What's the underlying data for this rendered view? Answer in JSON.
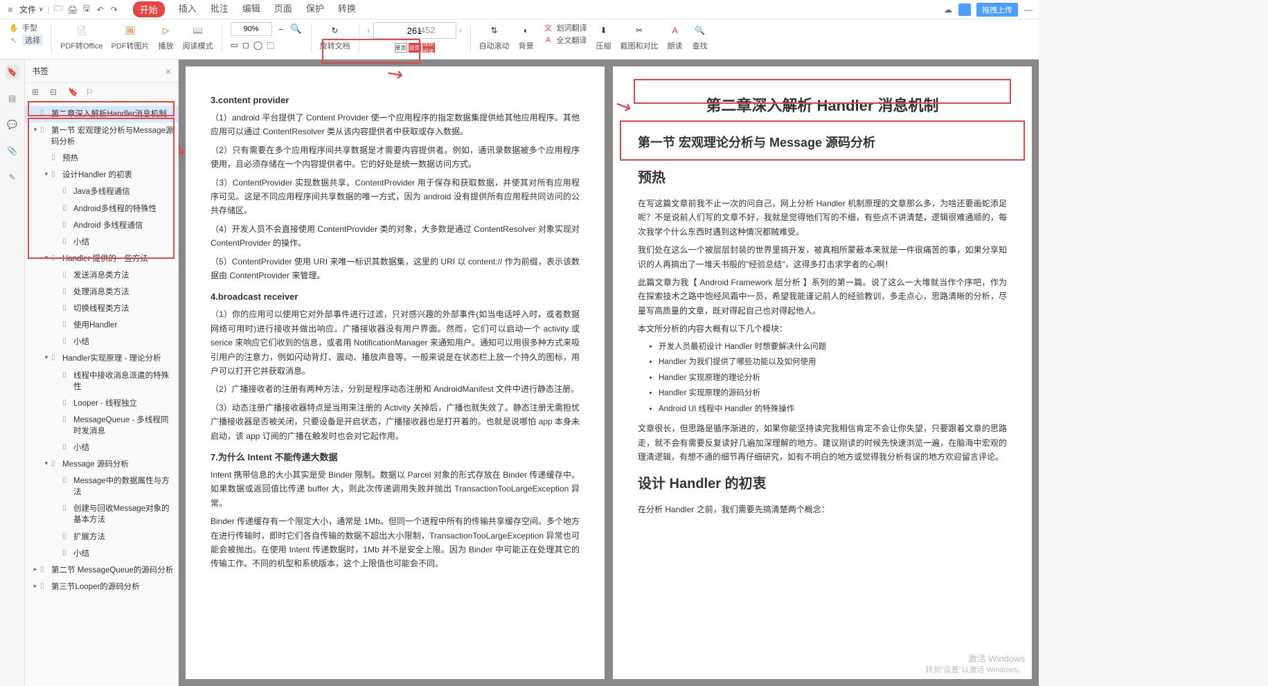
{
  "menubar": {
    "file": "文件",
    "tabs": [
      "开始",
      "插入",
      "批注",
      "编辑",
      "页面",
      "保护",
      "转换"
    ],
    "active_tab": 0,
    "upload": "拖拽上传"
  },
  "toolbar": {
    "hand": "手型",
    "select": "选择",
    "pdf_to_office": "PDF转Office",
    "pdf_to_image": "PDF转图片",
    "play": "播放",
    "read_mode": "阅读模式",
    "zoom_value": "90%",
    "rotate": "旋转文档",
    "page_current": "261",
    "page_total": "/452",
    "single_page": "单页",
    "double_page": "双页",
    "continuous": "连续阅读",
    "auto_scroll": "自动滚动",
    "background": "背景",
    "word_translate": "划词翻译",
    "full_translate": "全文翻译",
    "compress": "压缩",
    "screenshot": "截图和对比",
    "read_aloud": "朗读",
    "find": "查找"
  },
  "bookmark": {
    "title": "书签",
    "items": [
      {
        "level": 0,
        "exp": "",
        "text": "第二章深入解析Handler消息机制",
        "selected": true
      },
      {
        "level": 0,
        "exp": "▾",
        "text": "第一节 宏观理论分析与Message源码分析"
      },
      {
        "level": 1,
        "exp": "",
        "text": "预热"
      },
      {
        "level": 1,
        "exp": "▾",
        "text": "设计Handler 的初衷"
      },
      {
        "level": 2,
        "exp": "",
        "text": "Java多线程通信"
      },
      {
        "level": 2,
        "exp": "",
        "text": "Android多线程的特殊性"
      },
      {
        "level": 2,
        "exp": "",
        "text": "Android 多线程通信"
      },
      {
        "level": 2,
        "exp": "",
        "text": "小结"
      },
      {
        "level": 1,
        "exp": "▾",
        "text": "Handler 提供的一些方法"
      },
      {
        "level": 2,
        "exp": "",
        "text": "发送消息类方法"
      },
      {
        "level": 2,
        "exp": "",
        "text": "处理消息类方法"
      },
      {
        "level": 2,
        "exp": "",
        "text": "切换线程类方法"
      },
      {
        "level": 2,
        "exp": "",
        "text": "使用Handler"
      },
      {
        "level": 2,
        "exp": "",
        "text": "小结"
      },
      {
        "level": 1,
        "exp": "▾",
        "text": "Handler实现原理 - 理论分析"
      },
      {
        "level": 2,
        "exp": "",
        "text": "线程中接收消息派遣的特殊性"
      },
      {
        "level": 2,
        "exp": "",
        "text": "Looper - 线程独立"
      },
      {
        "level": 2,
        "exp": "",
        "text": "MessageQueue - 多线程同时发消息"
      },
      {
        "level": 2,
        "exp": "",
        "text": "小结"
      },
      {
        "level": 1,
        "exp": "▾",
        "text": "Message 源码分析"
      },
      {
        "level": 2,
        "exp": "",
        "text": "Message中的数据属性与方法"
      },
      {
        "level": 2,
        "exp": "",
        "text": "创建与回收Message对象的基本方法"
      },
      {
        "level": 2,
        "exp": "",
        "text": "扩展方法"
      },
      {
        "level": 2,
        "exp": "",
        "text": "小结"
      },
      {
        "level": 0,
        "exp": "▸",
        "text": "第二节 MessageQueue的源码分析"
      },
      {
        "level": 0,
        "exp": "▸",
        "text": "第三节Looper的源码分析"
      }
    ]
  },
  "left_page": {
    "s3_title": "3.content provider",
    "s3_p1": "（1）android 平台提供了 Content Provider 使一个应用程序的指定数据集提供给其他应用程序。其他应用可以通过 ContentResolver 类从该内容提供者中获取或存入数据。",
    "s3_p2": "（2）只有需要在多个应用程序间共享数据是才需要内容提供者。例如，通讯录数据被多个应用程序使用，且必须存储在一个内容提供者中。它的好处是统一数据访问方式。",
    "s3_p3": "（3）ContentProvider 实现数据共享。ContentProvider 用于保存和获取数据，并使其对所有应用程序可见。这是不同应用程序间共享数据的唯一方式，因为 android 没有提供所有应用程共同访问的公共存储区。",
    "s3_p4": "（4）开发人员不会直接使用 ContentProvider 类的对象，大多数是通过 ContentResolver 对象实现对 ContentProvider 的操作。",
    "s3_p5": "（5）ContentProvider 使用 URI 来唯一标识其数据集，这里的 URI 以 content:// 作为前缀，表示该数据由 ContentProvider 来管理。",
    "s4_title": "4.broadcast receiver",
    "s4_p1": "（1）你的应用可以使用它对外部事件进行过滤，只对感兴趣的外部事件(如当电话呼入时，或者数据网络可用时)进行接收并做出响应。广播接收器没有用户界面。然而，它们可以启动一个 activity 或 serice 来响应它们收到的信息，或者用 NotificationManager 来通知用户。通知可以用很多种方式来吸引用户的注意力，例如闪动背灯、震动、播放声音等。一般来说是在状态栏上放一个持久的图标，用户可以打开它并获取消息。",
    "s4_p2": "（2）广播接收者的注册有两种方法，分别是程序动态注册和 AndroidManifest 文件中进行静态注册。",
    "s4_p3": "（3）动态注册广播接收器特点是当用来注册的 Activity 关掉后，广播也就失效了。静态注册无需担忧广播接收器是否被关闭，只要设备是开启状态，广播接收器也是打开着的。也就是说哪怕 app 本身未启动，该 app 订阅的广播在触发时也会对它起作用。",
    "s7_title": "7.为什么 Intent 不能传递大数据",
    "s7_p1": "Intent 携带信息的大小其实是受 Binder 限制。数据以 Parcel 对象的形式存放在 Binder 传递缓存中。如果数据或返回值比传递 buffer 大，则此次传递调用失败并抛出 TransactionTooLargeException 异常。",
    "s7_p2": "Binder 传递缓存有一个限定大小，通常是 1Mb。但同一个进程中所有的传输共享缓存空间。多个地方在进行传输时，即时它们各自传输的数据不超出大小限制，TransactionTooLargeException 异常也可能会被抛出。在使用 Intent 传递数据时，1Mb 并不是安全上限。因为 Binder 中可能正在处理其它的传输工作。不同的机型和系统版本，这个上限值也可能会不同。"
  },
  "right_page": {
    "chapter_title": "第二章深入解析 Handler 消息机制",
    "section_title": "第一节  宏观理论分析与 Message 源码分析",
    "h_preheat": "预热",
    "preheat_p1": "在写这篇文章前我不止一次的问自己，网上分析 Handler 机制原理的文章那么多，为啥还要画蛇添足呢？不是说前人们写的文章不好，我就是觉得他们写的不细，有些点不讲清楚，逻辑很难通顺的，每次我学个什么东西时遇到这种情况都贼难受。",
    "preheat_p2": "我们处在这么一个被层层封装的世界里搞开发，被真相所蒙蔽本来就是一件很痛苦的事，如果分享知识的人再搞出了一堆天书般的\"经验总结\"，这得多打击求学者的心啊！",
    "preheat_p3": "此篇文章为我【 Android Framework 层分析 】系列的第一篇。说了这么一大堆就当作个序吧，作为在探索技术之路中饱经风霜中一员，希望我能谨记前人的经验教训，多走点心，思路清晰的分析，尽量写高质量的文章，既对得起自己也对得起他人。",
    "preheat_p4": "本文所分析的内容大概有以下几个模块：",
    "bullets": [
      "开发人员最初设计 Handler 时想要解决什么问题",
      "Handler 为我们提供了哪些功能以及如何使用",
      "Handler 实现原理的理论分析",
      "Handler 实现原理的源码分析",
      "Android UI 线程中 Handler 的特殊操作"
    ],
    "preheat_p5": "文章很长，但思路是循序渐进的，如果你能坚持读完我相信肯定不会让你失望，只要跟着文章的思路走，就不会有需要反复读好几遍加深理解的地方。建议刚读的时候先快速浏览一遍，在脑海中宏观的理清逻辑，有想不通的细节再仔细研究，如有不明白的地方或觉得我分析有误的地方欢迎留言评论。",
    "h_design": "设计 Handler 的初衷",
    "design_p1": "在分析 Handler 之前，我们需要先搞清楚两个概念："
  },
  "watermark": {
    "line1": "激活 Windows",
    "line2": "转到\"设置\"以激活 Windows。"
  }
}
